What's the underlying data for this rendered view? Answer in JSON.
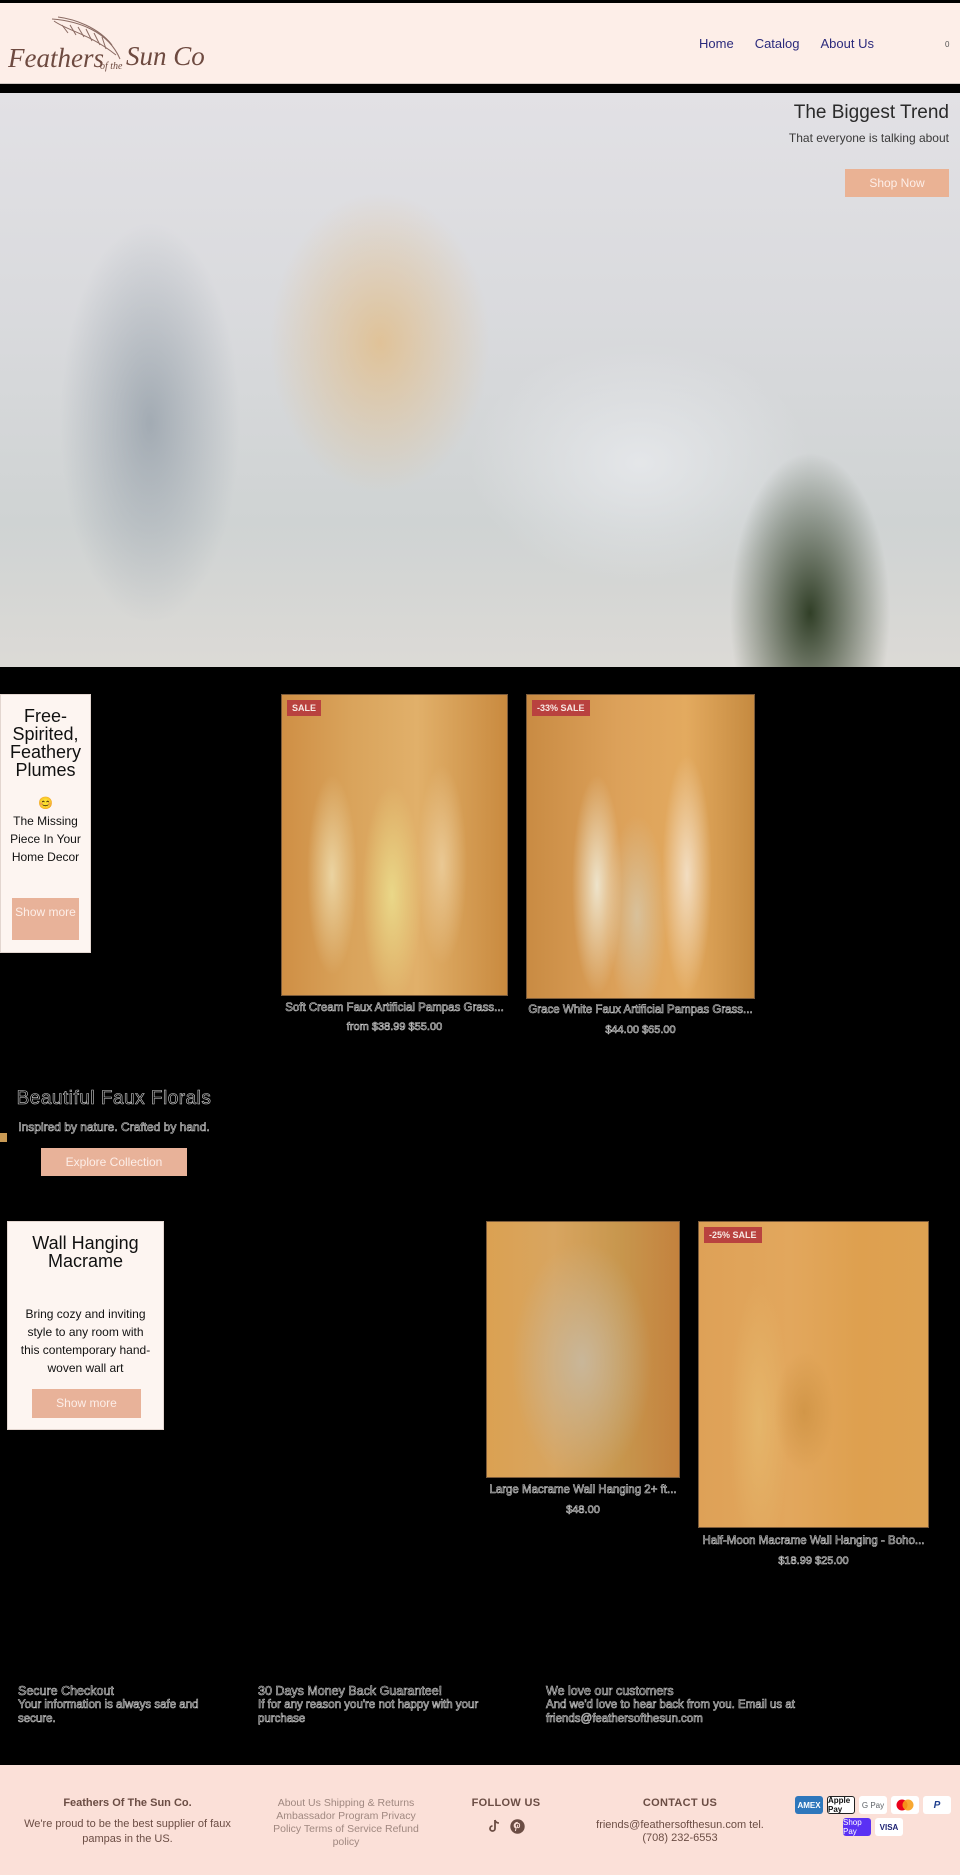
{
  "header": {
    "logo_text": "Feathers of the Sun Co.",
    "nav": [
      {
        "label": "Home"
      },
      {
        "label": "Catalog"
      },
      {
        "label": "About Us"
      }
    ],
    "cart_count": "0"
  },
  "hero": {
    "title": "The Biggest Trend",
    "subtitle": "That everyone is talking about",
    "button": "Shop Now"
  },
  "promo_pampas": {
    "title": "Free-Spirited, Feathery Plumes",
    "emoji": "😊",
    "text": "The Missing Piece In Your Home Decor",
    "button": "Show more"
  },
  "products_pampas": [
    {
      "badge": "SALE",
      "title": "Soft Cream Faux Artificial Pampas Grass...",
      "price": "from $38.99 $55.00"
    },
    {
      "badge": "-33% SALE",
      "title": "Grace White Faux Artificial Pampas Grass...",
      "price": "$44.00 $65.00"
    }
  ],
  "florals": {
    "title": "Beautiful Faux Florals",
    "subtitle": "Inspired by nature. Crafted by hand.",
    "button": "Explore Collection"
  },
  "promo_macrame": {
    "title": "Wall Hanging Macrame",
    "text": "Bring cozy and inviting style to any room with this contemporary hand-woven wall art",
    "button": "Show more"
  },
  "products_macrame": [
    {
      "badge": "",
      "title": "Large Macrame Wall Hanging 2+ ft...",
      "price": "$48.00"
    },
    {
      "badge": "-25% SALE",
      "title": "Half-Moon Macrame Wall Hanging - Boho...",
      "price": "$18.99 $25.00"
    }
  ],
  "trust": [
    {
      "title": "Secure Checkout",
      "text": "Your information is always safe and secure."
    },
    {
      "title": "30 Days Money Back Guarantee!",
      "text": "If for any reason you're not happy with your purchase"
    },
    {
      "title": "We love our customers",
      "text": "And we'd love to hear back from you. Email us at friends@feathersofthesun.com"
    }
  ],
  "footer": {
    "brand_title": "Feathers Of The Sun Co.",
    "brand_text": "We're proud to be the best supplier of faux pampas in the US.",
    "links": [
      "About Us",
      "Shipping & Returns",
      "Ambassador Program",
      "Privacy Policy",
      "Terms of Service",
      "Refund policy"
    ],
    "follow_title": "FOLLOW US",
    "social": [
      "tiktok-icon",
      "pinterest-icon"
    ],
    "contact_title": "CONTACT US",
    "contact_text": "friends@feathersofthesun.com tel. (708) 232-6553",
    "payments": [
      "AMEX",
      "Apple Pay",
      "G Pay",
      "Mastercard",
      "PayPal",
      "Shop Pay",
      "VISA"
    ]
  },
  "colors": {
    "accent_button": "#e8b299",
    "header_bg": "#fdeee8",
    "footer_bg": "#fbe0d8",
    "nav_link": "#2b2a7c",
    "sale_badge": "#b9423f",
    "brand_text": "#6b4d44"
  }
}
